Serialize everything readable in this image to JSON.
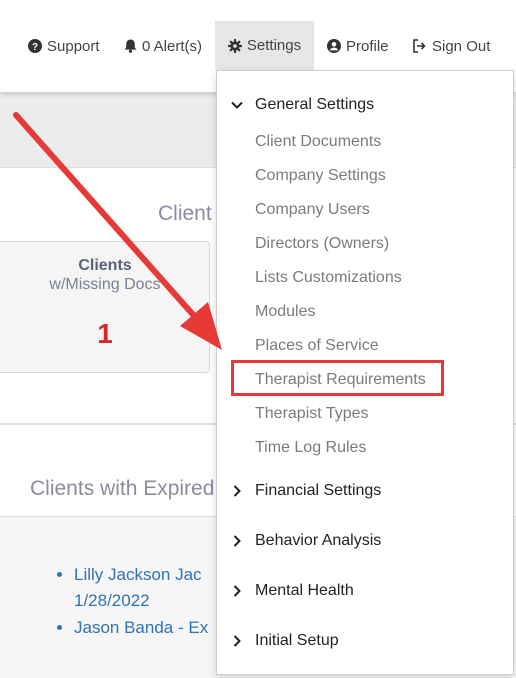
{
  "nav": {
    "support": "Support",
    "alerts": "0 Alert(s)",
    "settings": "Settings",
    "profile": "Profile",
    "sign_out": "Sign Out"
  },
  "dashboard": {
    "clients_heading": "Client",
    "stat_card": {
      "title": "Clients",
      "subtitle": "w/Missing Docs",
      "value": "1"
    },
    "expired_heading": "Clients with Expired",
    "expired_items": [
      "Lilly Jackson Jac 1/28/2022",
      "Jason Banda - Ex"
    ]
  },
  "menu": {
    "general": {
      "label": "General Settings",
      "items": [
        "Client Documents",
        "Company Settings",
        "Company Users",
        "Directors (Owners)",
        "Lists Customizations",
        "Modules",
        "Places of Service",
        "Therapist Requirements",
        "Therapist Types",
        "Time Log Rules"
      ]
    },
    "financial": "Financial Settings",
    "behavior": "Behavior Analysis",
    "mental": "Mental Health",
    "initial": "Initial Setup"
  },
  "colors": {
    "annotation_red": "#e53a35",
    "link_blue": "#2f73b5",
    "stat_red": "#d62b2b"
  },
  "annotation": {
    "highlighted_item": "Therapist Requirements"
  }
}
